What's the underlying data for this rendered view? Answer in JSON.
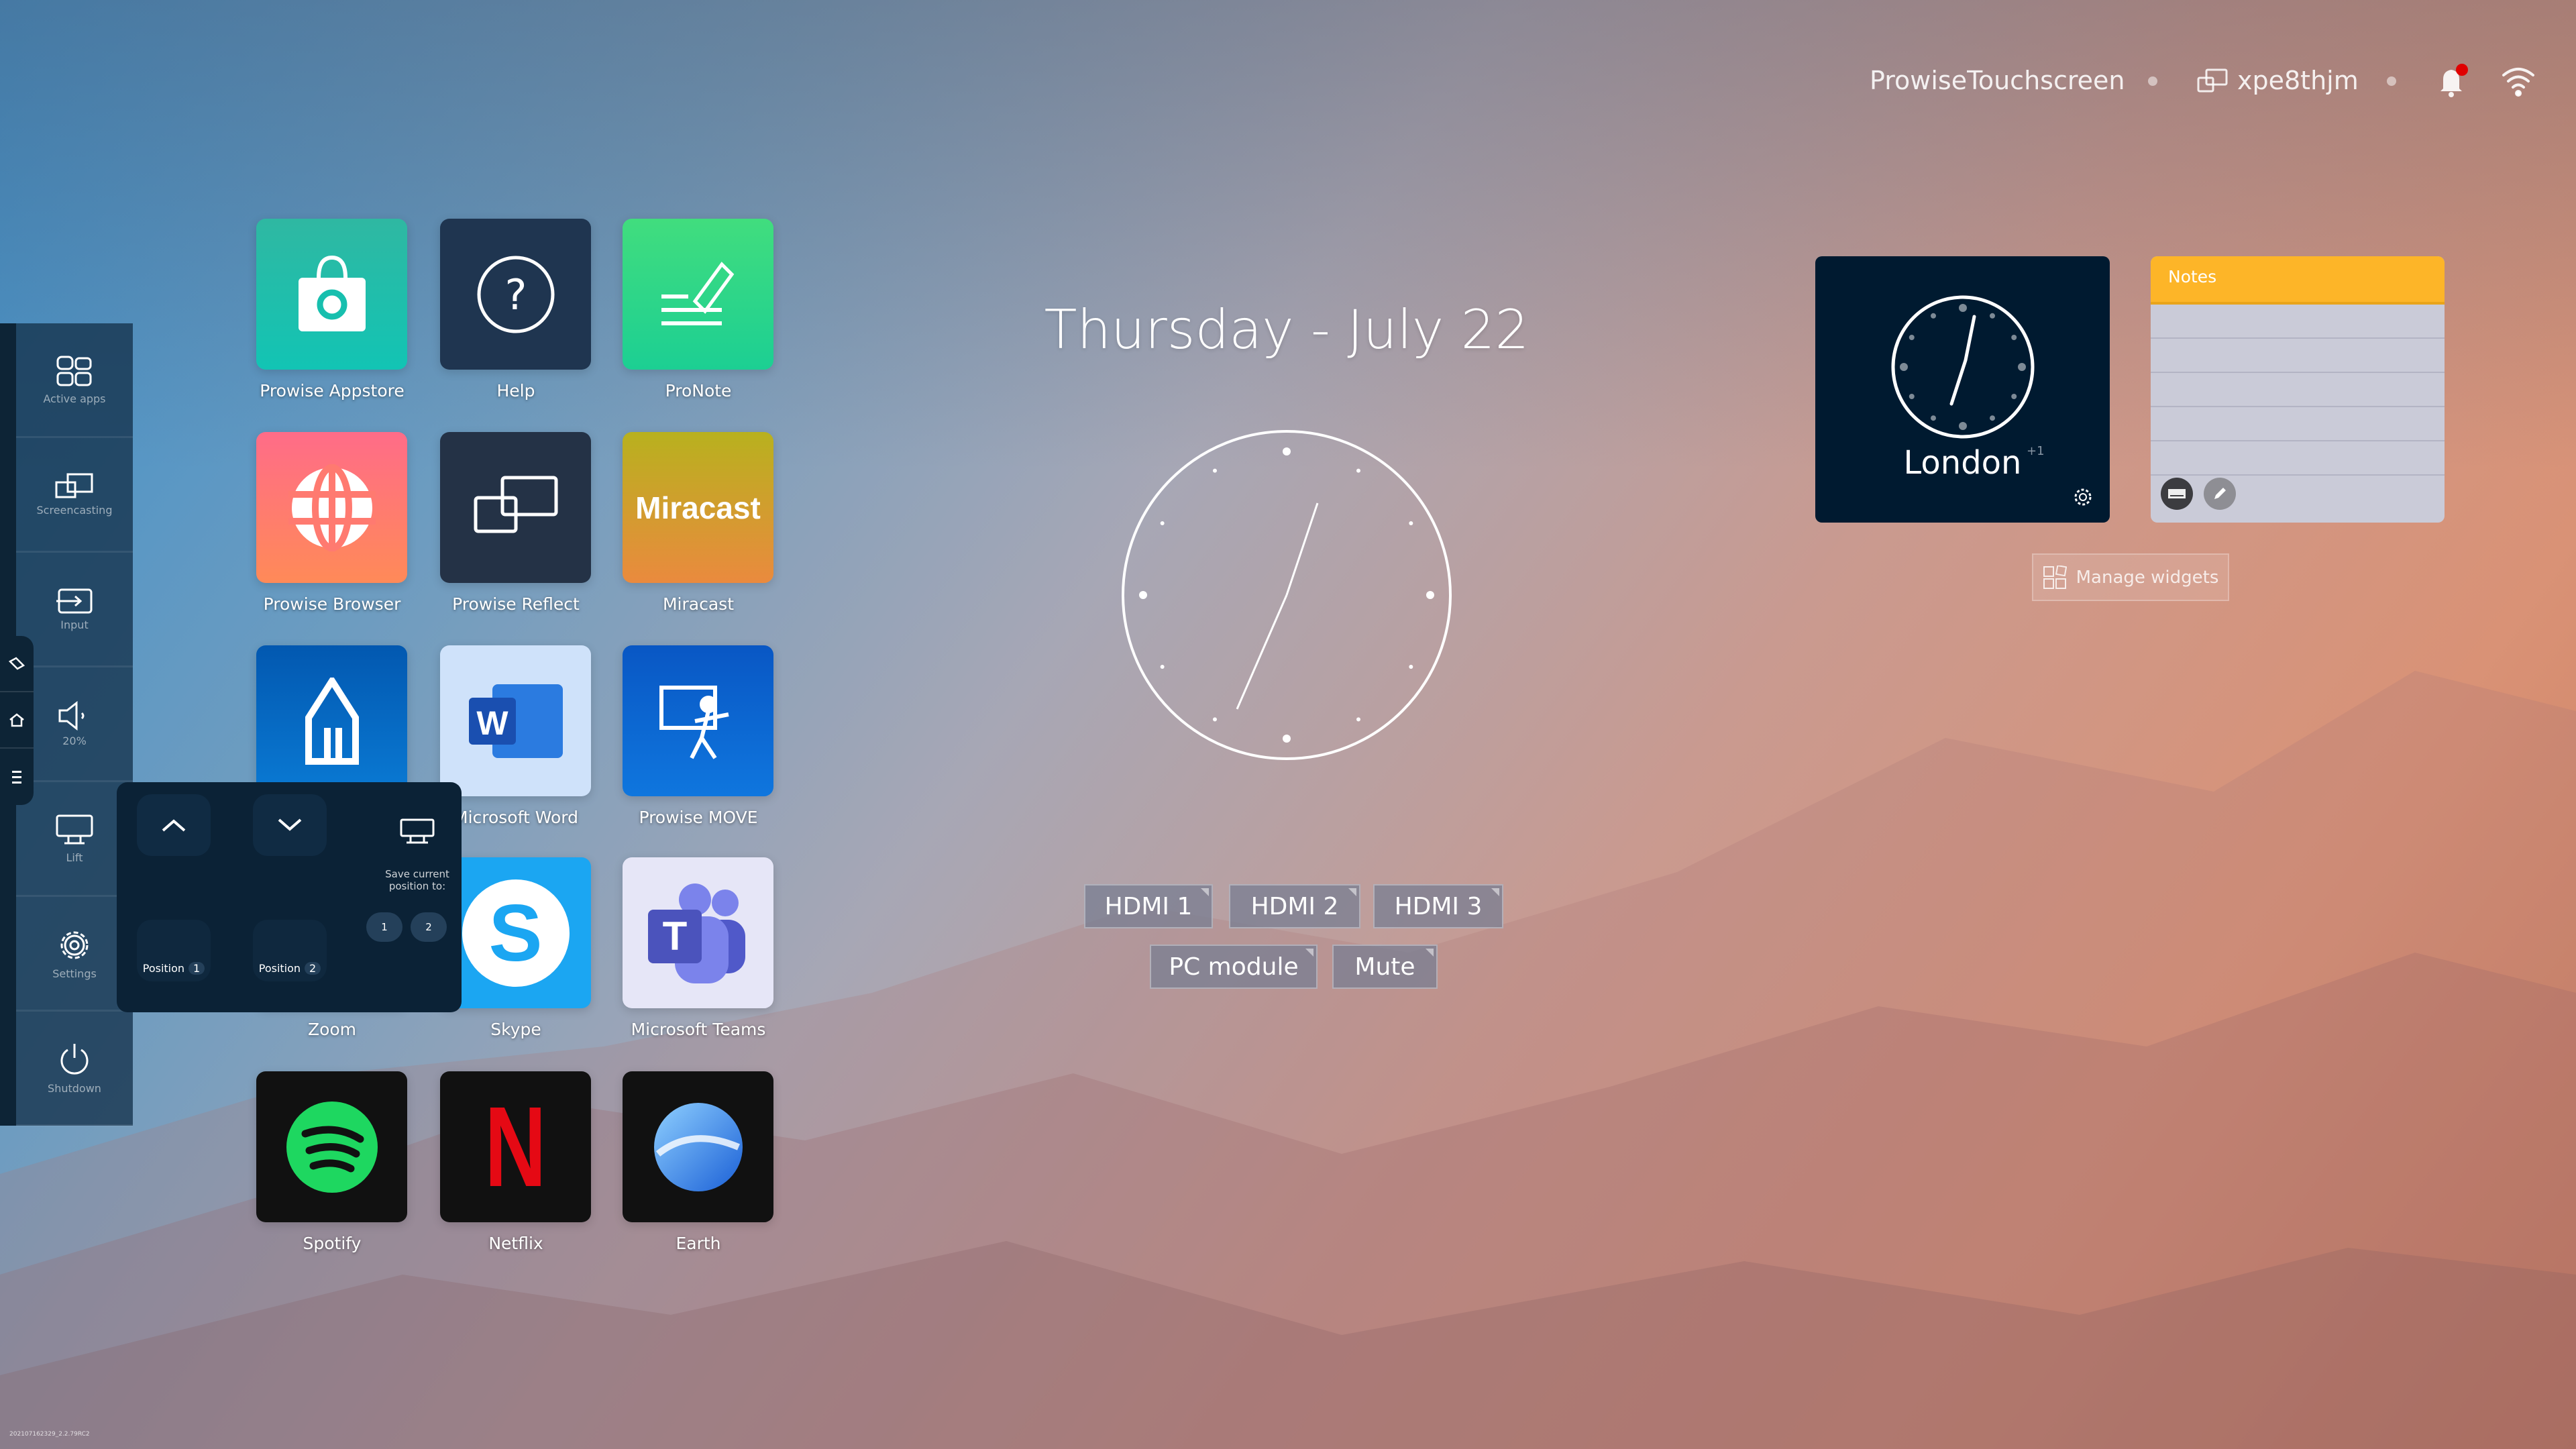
{
  "topbar": {
    "device_name": "ProwiseTouchscreen",
    "screencast_code": "xpe8thjm",
    "notification_dot_color": "#e00000"
  },
  "apps": [
    {
      "label": "Prowise Appstore",
      "icon": "shopping-bag-icon"
    },
    {
      "label": "Help",
      "icon": "question-icon"
    },
    {
      "label": "ProNote",
      "icon": "pen-note-icon"
    },
    {
      "label": "Prowise Browser",
      "icon": "globe-icon"
    },
    {
      "label": "Prowise Reflect",
      "icon": "screencast-icon"
    },
    {
      "label": "Miracast",
      "icon": "miracast-logo",
      "logo_text": "Miracast"
    },
    {
      "label": "",
      "icon": "pencil-icon"
    },
    {
      "label": "Microsoft Word",
      "icon": "word-icon",
      "logo_text": "W"
    },
    {
      "label": "Prowise MOVE",
      "icon": "move-icon"
    },
    {
      "label": "Zoom",
      "icon": "zoom-icon"
    },
    {
      "label": "Skype",
      "icon": "skype-icon",
      "logo_text": "S"
    },
    {
      "label": "Microsoft Teams",
      "icon": "teams-icon",
      "logo_text": "T"
    },
    {
      "label": "Spotify",
      "icon": "spotify-icon"
    },
    {
      "label": "Netflix",
      "icon": "netflix-icon",
      "logo_text": "N"
    },
    {
      "label": "Earth",
      "icon": "earth-icon"
    }
  ],
  "main": {
    "date": "Thursday - July 22"
  },
  "sources": {
    "hdmi1": "HDMI 1",
    "hdmi2": "HDMI 2",
    "hdmi3": "HDMI 3",
    "pc": "PC module",
    "mute": "Mute"
  },
  "sidebar": {
    "items": [
      {
        "label": "Active apps"
      },
      {
        "label": "Screencasting"
      },
      {
        "label": "Input"
      },
      {
        "label": "20%"
      },
      {
        "label": "Lift"
      },
      {
        "label": "Settings"
      },
      {
        "label": "Shutdown"
      }
    ]
  },
  "lift": {
    "save_label": "Save current position to:",
    "position_label": "Position",
    "pos1": "1",
    "pos2": "2",
    "save1": "1",
    "save2": "2"
  },
  "widgets": {
    "clock_city": "London",
    "clock_offset": "+1",
    "notes_title": "Notes",
    "notes_color": "#fdb528",
    "manage_label": "Manage widgets"
  },
  "version": "202107162329_2.2.79RC2"
}
